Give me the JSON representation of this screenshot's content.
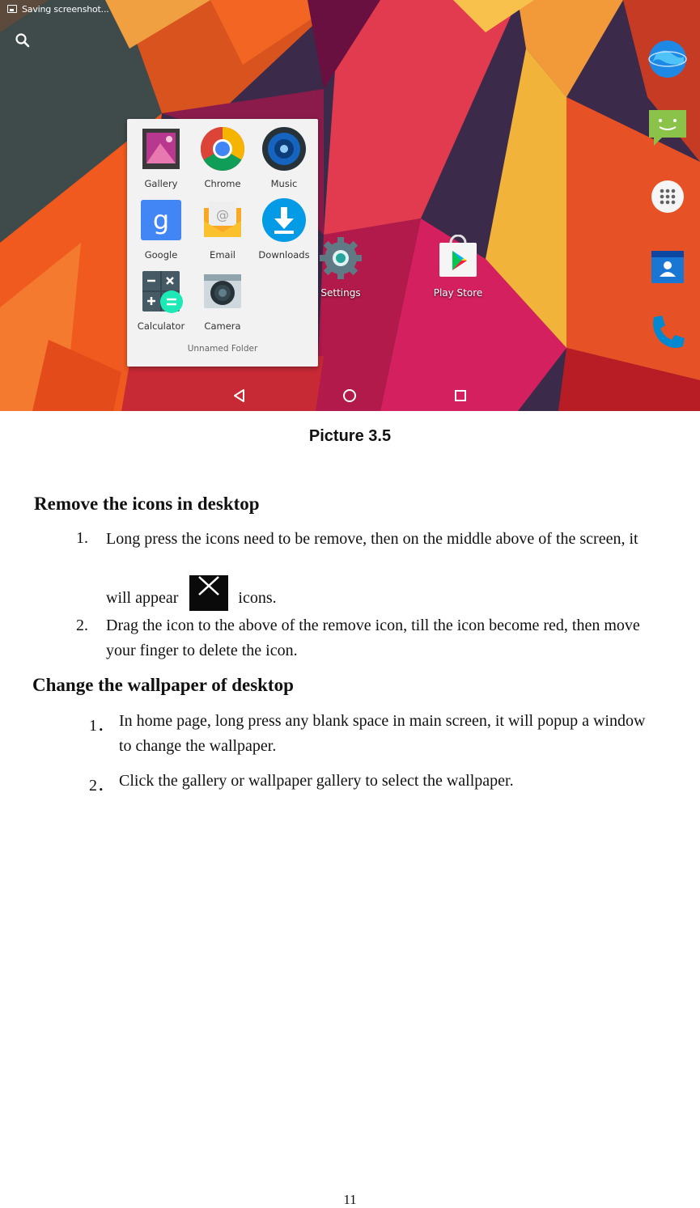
{
  "screenshot": {
    "status_text": "Saving screenshot...",
    "folder": {
      "name": "Unnamed Folder",
      "apps": [
        {
          "label": "Gallery",
          "icon": "gallery-icon"
        },
        {
          "label": "Chrome",
          "icon": "chrome-icon"
        },
        {
          "label": "Music",
          "icon": "music-icon"
        },
        {
          "label": "Google",
          "icon": "google-icon"
        },
        {
          "label": "Email",
          "icon": "email-icon"
        },
        {
          "label": "Downloads",
          "icon": "downloads-icon"
        },
        {
          "label": "Calculator",
          "icon": "calculator-icon"
        },
        {
          "label": "Camera",
          "icon": "camera-icon"
        }
      ]
    },
    "desktop_apps": [
      {
        "label": "Settings",
        "icon": "settings-icon"
      },
      {
        "label": "Play Store",
        "icon": "play-store-icon"
      }
    ],
    "dock_icons": [
      "browser-icon",
      "messaging-icon",
      "all-apps-icon",
      "contacts-icon",
      "phone-icon"
    ],
    "nav_icons": [
      "back-icon",
      "home-icon",
      "recents-icon"
    ],
    "colors": {
      "wall_orange": "#f05a1e",
      "wall_magenta": "#d81b60",
      "nav_blue": "#1c3a6b"
    }
  },
  "caption": "Picture 3.5",
  "section1": {
    "heading": "Remove the icons in desktop",
    "items": [
      {
        "num": "1.",
        "line1": "Long press the icons need to be remove, then on the middle above of the screen, it",
        "pre": "will appear",
        "post": "icons."
      },
      {
        "num": "2.",
        "line1": "Drag the icon to the above of the remove icon, till the icon become red, then move",
        "line2": "your finger to delete the icon."
      }
    ]
  },
  "section2": {
    "heading": "Change the wallpaper of desktop",
    "items": [
      {
        "num": "1．",
        "line1": "In home page, long press any blank space in main screen, it will popup a window",
        "line2": "to change the wallpaper."
      },
      {
        "num": "2．",
        "line1": "Click the gallery or wallpaper gallery to select the wallpaper."
      }
    ]
  },
  "page_number": "11"
}
